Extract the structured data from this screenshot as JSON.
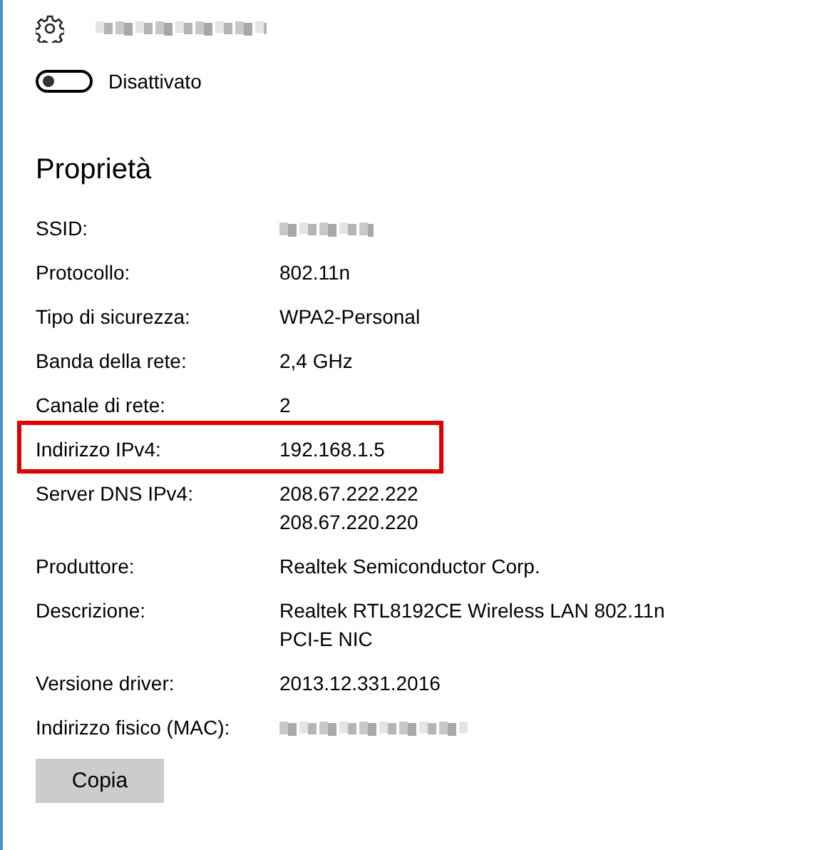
{
  "toggle": {
    "on": false,
    "label": "Disattivato"
  },
  "section_title": "Proprietà",
  "properties": [
    {
      "label": "SSID:",
      "kind": "redacted",
      "highlighted": false
    },
    {
      "label": "Protocollo:",
      "kind": "text",
      "value": [
        "802.11n"
      ],
      "highlighted": false
    },
    {
      "label": "Tipo di sicurezza:",
      "kind": "text",
      "value": [
        "WPA2-Personal"
      ],
      "highlighted": false
    },
    {
      "label": "Banda della rete:",
      "kind": "text",
      "value": [
        "2,4 GHz"
      ],
      "highlighted": false
    },
    {
      "label": "Canale di rete:",
      "kind": "text",
      "value": [
        "2"
      ],
      "highlighted": false
    },
    {
      "label": "Indirizzo IPv4:",
      "kind": "text",
      "value": [
        "192.168.1.5"
      ],
      "highlighted": true
    },
    {
      "label": "Server DNS IPv4:",
      "kind": "text",
      "value": [
        "208.67.222.222",
        "208.67.220.220"
      ],
      "highlighted": false
    },
    {
      "label": "Produttore:",
      "kind": "text",
      "value": [
        "Realtek Semiconductor Corp."
      ],
      "highlighted": false
    },
    {
      "label": "Descrizione:",
      "kind": "text",
      "value": [
        "Realtek RTL8192CE Wireless LAN 802.11n",
        "PCI-E NIC"
      ],
      "highlighted": false
    },
    {
      "label": "Versione driver:",
      "kind": "text",
      "value": [
        "2013.12.331.2016"
      ],
      "highlighted": false
    },
    {
      "label": "Indirizzo fisico (MAC):",
      "kind": "redacted",
      "highlighted": false
    }
  ],
  "copy_button": "Copia"
}
